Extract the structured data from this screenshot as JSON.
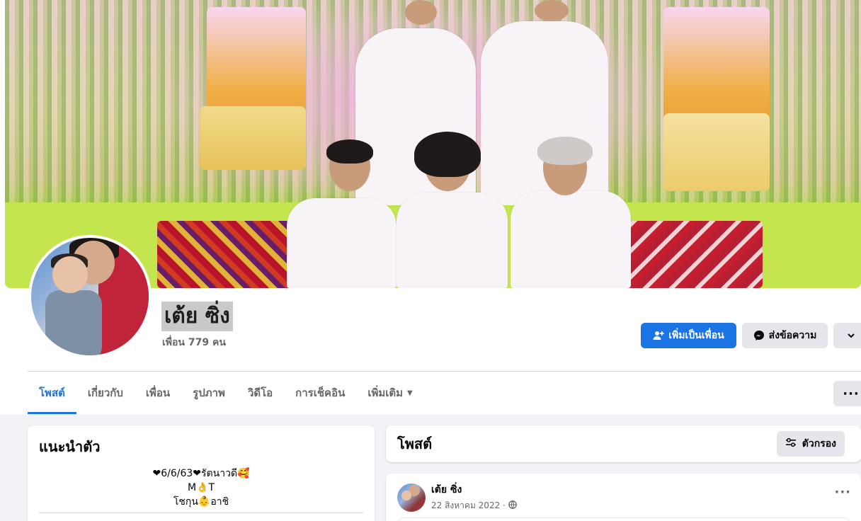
{
  "profile": {
    "name": "เต้ย ซิ่ง",
    "friends": "เพื่อน 779 คน"
  },
  "actions": {
    "add_friend": "เพิ่มเป็นเพื่อน",
    "message": "ส่งข้อความ"
  },
  "tabs": [
    {
      "label": "โพสต์",
      "active": true
    },
    {
      "label": "เกี่ยวกับ"
    },
    {
      "label": "เพื่อน"
    },
    {
      "label": "รูปภาพ"
    },
    {
      "label": "วิดีโอ"
    },
    {
      "label": "การเช็คอิน"
    },
    {
      "label": "เพิ่มเติม"
    }
  ],
  "intro": {
    "title": "แนะนำตัว",
    "bio_lines": [
      "❤6/6/63❤รัตนาวดี🥰",
      "M👌T",
      "โชกุน👶อาชิ"
    ]
  },
  "posts": {
    "title": "โพสต์",
    "filter_label": "ตัวกรอง"
  },
  "post": {
    "author": "เต้ย ซิ่ง",
    "date": "22 สิงหาคม 2022 ·"
  },
  "colors": {
    "accent": "#1b74e4",
    "secondary_button": "#e4e6eb",
    "page_bg": "#f0f2f5"
  },
  "icons": {
    "add_friend": "person-plus-icon",
    "message": "messenger-icon",
    "more": "chevron-down-icon",
    "filter": "sliders-icon",
    "audience": "globe-icon"
  }
}
